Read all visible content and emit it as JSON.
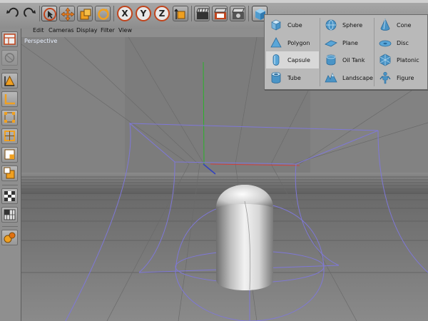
{
  "menubar": {
    "items": [
      "Edit",
      "Cameras",
      "Display",
      "Filter",
      "View"
    ]
  },
  "viewport": {
    "label": "Perspective"
  },
  "primitives_menu": {
    "columns": [
      [
        {
          "label": "Cube",
          "icon": "cube-icon"
        },
        {
          "label": "Polygon",
          "icon": "polygon-icon"
        },
        {
          "label": "Capsule",
          "icon": "capsule-icon",
          "highlighted": true
        },
        {
          "label": "Tube",
          "icon": "tube-icon"
        }
      ],
      [
        {
          "label": "Sphere",
          "icon": "sphere-icon"
        },
        {
          "label": "Plane",
          "icon": "plane-icon"
        },
        {
          "label": "Oil Tank",
          "icon": "oil-tank-icon"
        },
        {
          "label": "Landscape",
          "icon": "landscape-icon"
        }
      ],
      [
        {
          "label": "Cone",
          "icon": "cone-icon"
        },
        {
          "label": "Disc",
          "icon": "disc-icon"
        },
        {
          "label": "Platonic",
          "icon": "platonic-icon"
        },
        {
          "label": "Figure",
          "icon": "figure-icon"
        }
      ]
    ]
  },
  "toolbar": {
    "axis_x": "X",
    "axis_y": "Y",
    "axis_z": "Z"
  },
  "colors": {
    "accent_orange": "#d4551c",
    "icon_blue": "#3f8fc9",
    "deformer_lines": "#7f78d8",
    "viewport_bg": "#808080"
  }
}
